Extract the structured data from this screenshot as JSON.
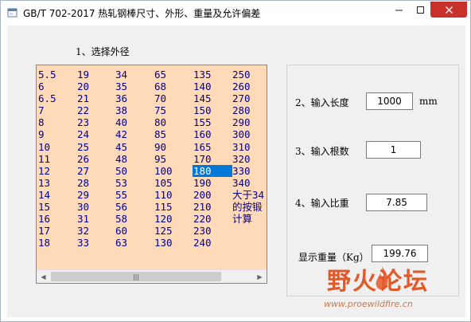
{
  "window": {
    "title": "GB/T 702-2017 热轧钢棒尺寸、外形、重量及允许偏差",
    "minimize_icon": "minimize-icon",
    "maximize_icon": "maximize-icon",
    "close_icon": "close-icon"
  },
  "step1": {
    "label": "1、选择外径"
  },
  "diameters": {
    "columns": [
      [
        "5.5",
        "6",
        "6.5",
        "7",
        "8",
        "9",
        "10",
        "11",
        "12",
        "13",
        "14",
        "15",
        "16",
        "17",
        "18"
      ],
      [
        "19",
        "20",
        "21",
        "22",
        "23",
        "24",
        "25",
        "26",
        "27",
        "28",
        "29",
        "30",
        "31",
        "32",
        "33"
      ],
      [
        "34",
        "35",
        "36",
        "38",
        "40",
        "42",
        "45",
        "48",
        "50",
        "53",
        "55",
        "56",
        "58",
        "60",
        "63"
      ],
      [
        "65",
        "68",
        "70",
        "75",
        "80",
        "85",
        "90",
        "95",
        "100",
        "105",
        "110",
        "115",
        "120",
        "125",
        "130"
      ],
      [
        "135",
        "140",
        "145",
        "150",
        "155",
        "160",
        "165",
        "170",
        "180",
        "190",
        "200",
        "210",
        "220",
        "230",
        "240"
      ],
      [
        "250",
        "260",
        "270",
        "280",
        "290",
        "300",
        "310",
        "320",
        "330",
        "340",
        "大于34",
        "的按锻",
        "计算"
      ]
    ],
    "selected": "180",
    "text_color": "#00008b",
    "background": "#ffdab9"
  },
  "step2": {
    "label": "2、输入长度",
    "value": "1000",
    "unit": "mm"
  },
  "step3": {
    "label": "3、输入根数",
    "value": "1"
  },
  "step4": {
    "label": "4、输入比重",
    "value": "7.85"
  },
  "result": {
    "label": "显示重量（Kg）",
    "value": "199.76"
  },
  "watermark": {
    "text": "野火论坛",
    "url": "www.proewildfire.cn"
  }
}
